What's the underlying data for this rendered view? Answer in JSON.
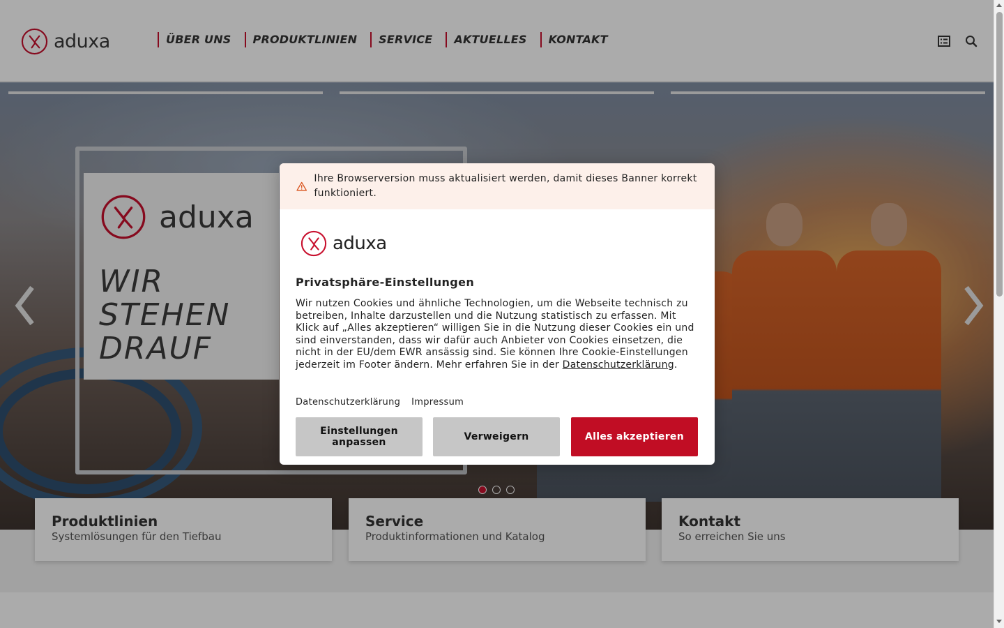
{
  "header": {
    "logo_text": "aduxa",
    "nav": [
      {
        "label": "ÜBER UNS"
      },
      {
        "label": "PRODUKTLINIEN"
      },
      {
        "label": "SERVICE"
      },
      {
        "label": "AKTUELLES"
      },
      {
        "label": "KONTAKT"
      }
    ],
    "icons": {
      "menu": "list-icon",
      "search": "search-icon"
    }
  },
  "hero": {
    "banner_logo_text": "aduxa",
    "banner_slogan": [
      "WIR",
      "STEHEN",
      "DRAUF"
    ],
    "slider": {
      "slide_count": 3,
      "active_index": 0
    }
  },
  "cards": [
    {
      "title": "Produktlinien",
      "subtitle": "Systemlösungen für den Tiefbau"
    },
    {
      "title": "Service",
      "subtitle": "Produktinformationen und Katalog"
    },
    {
      "title": "Kontakt",
      "subtitle": "So erreichen Sie uns"
    }
  ],
  "cookie_banner": {
    "warning": "Ihre Browserversion muss aktualisiert werden, damit dieses Banner korrekt funktioniert.",
    "logo_text": "aduxa",
    "title": "Privatsphäre-Einstellungen",
    "body_text": "Wir nutzen Cookies und ähnliche Technologien, um die Webseite technisch zu betreiben, Inhalte darzustellen und die Nutzung statistisch zu erfassen. Mit Klick auf „Alles akzeptieren“ willigen Sie in die Nutzung dieser Cookies ein und sind einverstanden, dass wir dafür auch Anbieter von Cookies einsetzen, die nicht in der EU/dem EWR ansässig sind. Sie können Ihre Cookie-Einstellungen jederzeit im Footer ändern. Mehr erfahren Sie in der ",
    "body_link": "Datenschutzerklärung",
    "body_end": ".",
    "links": [
      "Datenschutzerklärung",
      "Impressum"
    ],
    "buttons": {
      "settings": "Einstellungen anpassen",
      "deny": "Verweigern",
      "accept": "Alles akzeptieren"
    }
  },
  "colors": {
    "brand_red": "#c10d24",
    "warning_bg": "#fdf0ea"
  }
}
